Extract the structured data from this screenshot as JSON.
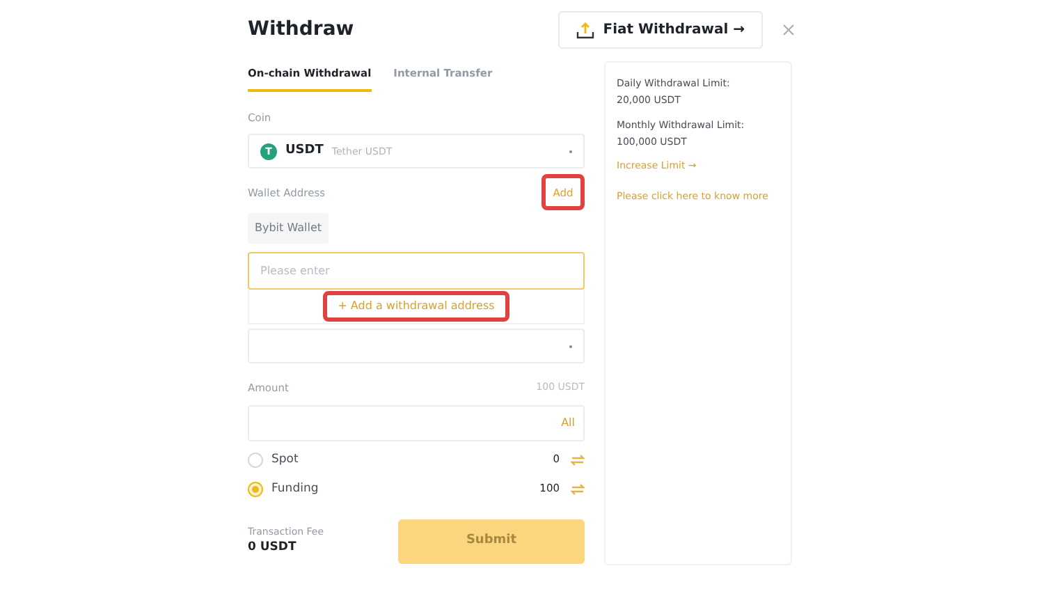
{
  "title": "Withdraw",
  "fiat_button": {
    "label": "Fiat Withdrawal →"
  },
  "tabs": [
    {
      "label": "On-chain Withdrawal",
      "selected": true
    },
    {
      "label": "Internal Transfer",
      "selected": false
    }
  ],
  "coin": {
    "label": "Coin",
    "symbol": "USDT",
    "name": "Tether USDT",
    "icon": "T"
  },
  "wallet": {
    "label": "Wallet Address",
    "add_label": "Add",
    "add_highlighted": true,
    "chip": "Bybit Wallet",
    "placeholder": "Please enter",
    "add_address": "+ Add a withdrawal address",
    "add_address_highlighted": true
  },
  "amount": {
    "label": "Amount",
    "balance": "100 USDT",
    "all": "All"
  },
  "accounts": [
    {
      "label": "Spot",
      "value": "0",
      "selected": false
    },
    {
      "label": "Funding",
      "value": "100",
      "selected": true
    }
  ],
  "fee": {
    "label": "Transaction Fee",
    "value": "0 USDT"
  },
  "submit": {
    "label": "Submit",
    "disabled": true
  },
  "limits": {
    "lines": [
      "Daily Withdrawal Limit:",
      "20,000 USDT",
      "Monthly Withdrawal Limit:",
      "100,000 USDT"
    ],
    "increase": "Increase Limit →",
    "know_more": "Please click here to know more"
  }
}
